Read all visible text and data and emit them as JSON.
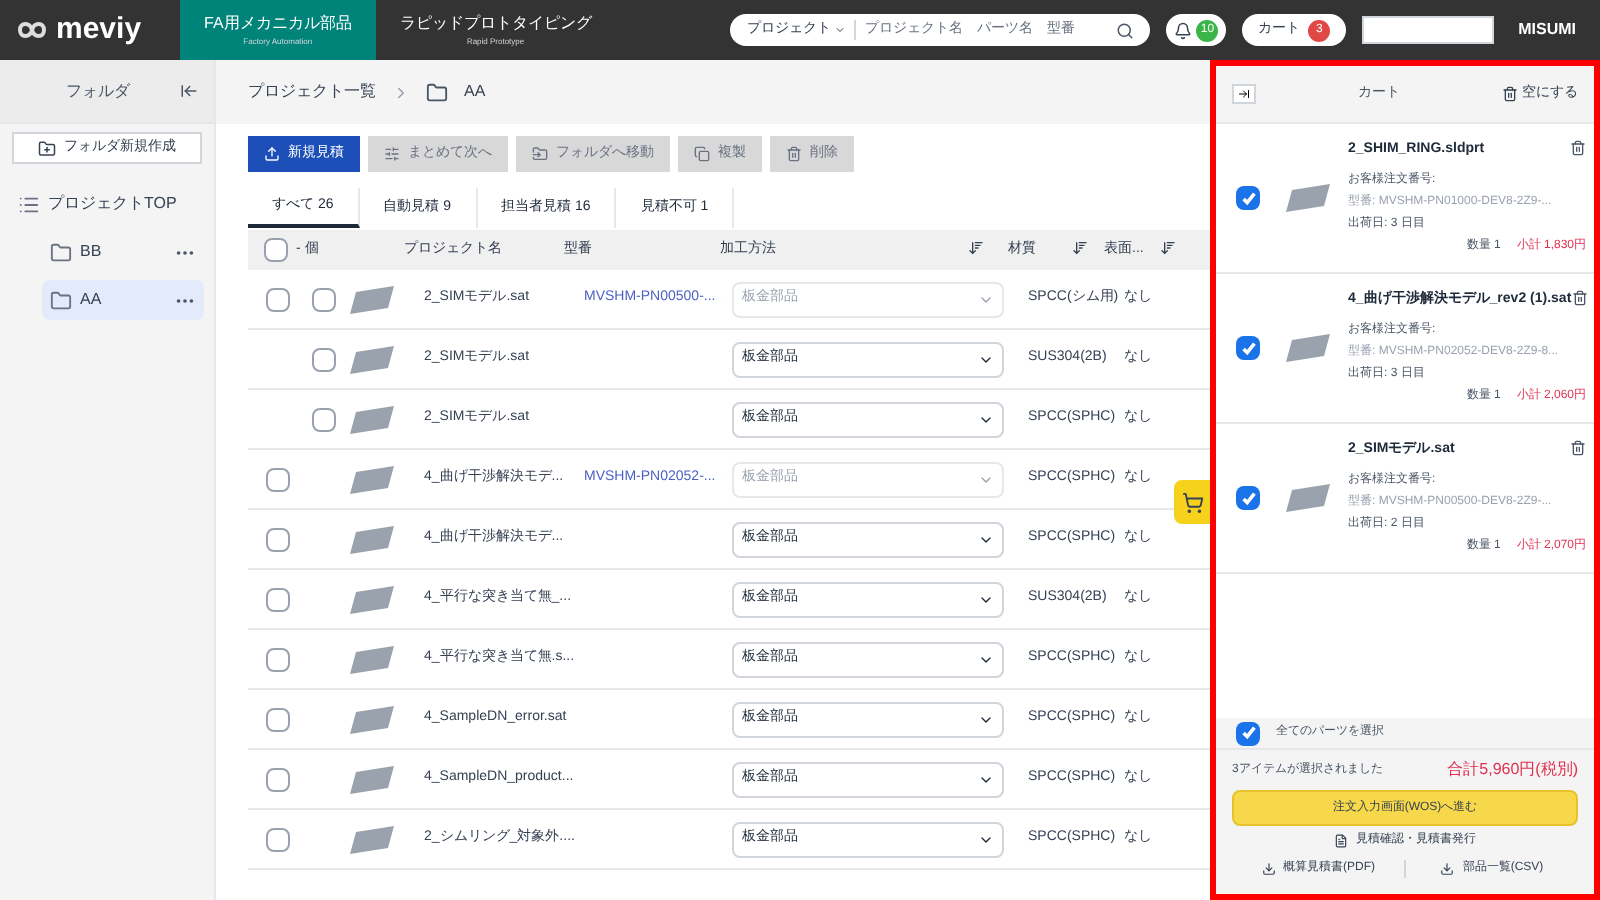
{
  "header": {
    "logo": "meviy",
    "nav": [
      {
        "title": "FA用メカニカル部品",
        "subtitle": "Factory Automation",
        "selected": true
      },
      {
        "title": "ラピッドプロトタイピング",
        "subtitle": "Rapid Prototype",
        "selected": false
      }
    ],
    "search": {
      "scope": "プロジェクト",
      "placeholder": "プロジェクト名　パーツ名　型番"
    },
    "notifications": "10",
    "cart": {
      "label": "カート",
      "count": "3"
    },
    "brand": "MISUMI"
  },
  "sidebar": {
    "title": "フォルダ",
    "new_folder": "フォルダ新規作成",
    "tree": [
      {
        "label": "プロジェクトTOP",
        "selected": false,
        "children": [
          {
            "label": "BB",
            "selected": false
          },
          {
            "label": "AA",
            "selected": true
          }
        ]
      }
    ]
  },
  "breadcrumb": [
    "プロジェクト一覧",
    "AA"
  ],
  "toolbar": [
    {
      "label": "新規見積",
      "disabled": false
    },
    {
      "label": "まとめて次へ",
      "disabled": true
    },
    {
      "label": "フォルダへ移動",
      "disabled": true
    },
    {
      "label": "複製",
      "disabled": true
    },
    {
      "label": "削除",
      "disabled": true
    }
  ],
  "tabs": [
    {
      "label": "すべて 26",
      "selected": true
    },
    {
      "label": "自動見積 9",
      "selected": false
    },
    {
      "label": "担当者見積 16",
      "selected": false
    },
    {
      "label": "見積不可 1",
      "selected": false
    }
  ],
  "table": {
    "select_all": "- 個",
    "select_all_checked": false,
    "columns": [
      "プロジェクト名",
      "型番",
      "加工方法",
      "材質",
      "表面..."
    ],
    "rows": [
      {
        "kind": "group",
        "name": "2_SIMモデル.sat",
        "model": "MVSHM-PN00500-...",
        "method": "板金部品",
        "method_disabled": true,
        "material": "SPCC(シム用)",
        "surface": "なし",
        "checked": false,
        "child_checked": false
      },
      {
        "kind": "child",
        "name": "2_SIMモデル.sat",
        "method": "板金部品",
        "method_disabled": false,
        "material": "SUS304(2B)",
        "surface": "なし",
        "checked": false
      },
      {
        "kind": "child",
        "name": "2_SIMモデル.sat",
        "method": "板金部品",
        "method_disabled": false,
        "material": "SPCC(SPHC)",
        "surface": "なし",
        "checked": false
      },
      {
        "kind": "single",
        "name": "4_曲げ干渉解決モデ...",
        "model": "MVSHM-PN02052-...",
        "method": "板金部品",
        "method_disabled": true,
        "material": "SPCC(SPHC)",
        "surface": "なし",
        "checked": false
      },
      {
        "kind": "single",
        "name": "4_曲げ干渉解決モデ...",
        "method": "板金部品",
        "method_disabled": false,
        "material": "SPCC(SPHC)",
        "surface": "なし",
        "checked": false
      },
      {
        "kind": "single",
        "name": "4_平行な突き当て無_...",
        "method": "板金部品",
        "method_disabled": false,
        "material": "SUS304(2B)",
        "surface": "なし",
        "checked": false
      },
      {
        "kind": "single",
        "name": "4_平行な突き当て無.s...",
        "method": "板金部品",
        "method_disabled": false,
        "material": "SPCC(SPHC)",
        "surface": "なし",
        "checked": false
      },
      {
        "kind": "single",
        "name": "4_SampleDN_error.sat",
        "method": "板金部品",
        "method_disabled": false,
        "material": "SPCC(SPHC)",
        "surface": "なし",
        "checked": false
      },
      {
        "kind": "single",
        "name": "4_SampleDN_product...",
        "method": "板金部品",
        "method_disabled": false,
        "material": "SPCC(SPHC)",
        "surface": "なし",
        "checked": false
      },
      {
        "kind": "single",
        "name": "2_シムリング_対象外....",
        "method": "板金部品",
        "method_disabled": false,
        "material": "SPCC(SPHC)",
        "surface": "なし",
        "checked": false
      }
    ]
  },
  "cart": {
    "title": "カート",
    "empty": "空にする",
    "items": [
      {
        "name": "2_SHIM_RING.sldprt",
        "order_no": "お客様注文番号:",
        "model": "型番: MVSHM-PN01000-DEV8-2Z9-...",
        "ship": "出荷日: 3 日目",
        "qty": "数量 1",
        "subtotal": "小計 1,830円",
        "checked": true
      },
      {
        "name": "4_曲げ干渉解決モデル_rev2 (1).sat",
        "order_no": "お客様注文番号:",
        "model": "型番: MVSHM-PN02052-DEV8-2Z9-8...",
        "ship": "出荷日: 3 日目",
        "qty": "数量 1",
        "subtotal": "小計 2,060円",
        "checked": true
      },
      {
        "name": "2_SIMモデル.sat",
        "order_no": "お客様注文番号:",
        "model": "型番: MVSHM-PN00500-DEV8-2Z9-...",
        "ship": "出荷日: 2 日目",
        "qty": "数量 1",
        "subtotal": "小計 2,070円",
        "checked": true
      }
    ],
    "select_all": {
      "label": "全てのパーツを選択",
      "checked": true
    },
    "selected_count": "3アイテムが選択されました",
    "total": "合計5,960円(税別)",
    "order_button": "注文入力画面(WOS)へ進む",
    "quote_link": "見積確認・見積書発行",
    "pdf": "概算見積書(PDF)",
    "csv": "部品一覧(CSV)"
  }
}
